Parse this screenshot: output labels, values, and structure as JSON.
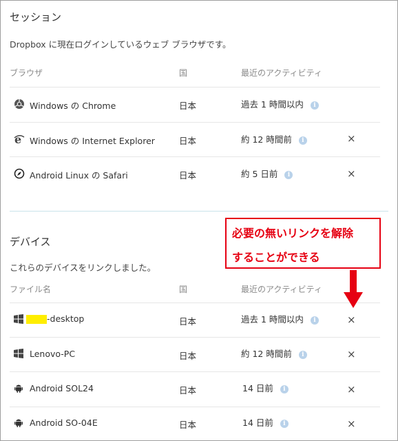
{
  "sessions": {
    "title": "セッション",
    "description": "Dropbox に現在ログインしているウェブ ブラウザです。",
    "headers": {
      "browser": "ブラウザ",
      "country": "国",
      "activity": "最近のアクティビティ"
    },
    "rows": [
      {
        "icon": "chrome-icon",
        "name": "Windows の Chrome",
        "country": "日本",
        "activity": "過去 1 時間以内",
        "removable": false
      },
      {
        "icon": "internet-explorer-icon",
        "name": "Windows の Internet Explorer",
        "country": "日本",
        "activity": "約 12 時間前",
        "removable": true
      },
      {
        "icon": "safari-icon",
        "name": "Android Linux の Safari",
        "country": "日本",
        "activity": "約 5 日前",
        "removable": true
      }
    ]
  },
  "devices": {
    "title": "デバイス",
    "description": "これらのデバイスをリンクしました。",
    "headers": {
      "name": "ファイル名",
      "country": "国",
      "activity": "最近のアクティビティ"
    },
    "rows": [
      {
        "icon": "windows-icon",
        "name": "-desktop",
        "country": "日本",
        "activity": "過去 1 時間以内",
        "removable": true
      },
      {
        "icon": "windows-icon",
        "name": "Lenovo-PC",
        "country": "日本",
        "activity": "約 12 時間前",
        "removable": true
      },
      {
        "icon": "android-icon",
        "name": "Android SOL24",
        "country": "日本",
        "activity": "14 日前",
        "removable": true
      },
      {
        "icon": "android-icon",
        "name": "Android SO-04E",
        "country": "日本",
        "activity": "14 日前",
        "removable": true
      }
    ]
  },
  "callout": {
    "line1": "必要の無いリンクを解除",
    "line2": "することができる"
  },
  "glyphs": {
    "info": "i",
    "close": "×"
  },
  "colors": {
    "callout_red": "#e60012",
    "info_blue": "#b9d2ea",
    "highlight_yellow": "#ffee00"
  }
}
